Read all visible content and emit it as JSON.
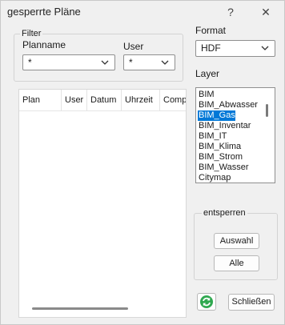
{
  "window": {
    "title": "gesperrte Pläne",
    "help_glyph": "?",
    "close_glyph": "✕"
  },
  "filter": {
    "group_label": "Filter",
    "planname_label": "Planname",
    "planname_value": "*",
    "user_label": "User",
    "user_value": "*"
  },
  "table": {
    "headers": [
      "Plan",
      "User",
      "Datum",
      "Uhrzeit",
      "Compu"
    ]
  },
  "format": {
    "label": "Format",
    "value": "HDF"
  },
  "layer": {
    "label": "Layer",
    "items": [
      "BIM",
      "BIM_Abwasser",
      "BIM_Gas",
      "BIM_Inventar",
      "BIM_IT",
      "BIM_Klima",
      "BIM_Strom",
      "BIM_Wasser",
      "Citymap"
    ],
    "selected": "BIM_Gas"
  },
  "entsperren": {
    "label": "entsperren",
    "auswahl": "Auswahl",
    "alle": "Alle"
  },
  "footer": {
    "close_label": "Schließen",
    "refresh_icon": "refresh-icon",
    "accent": "#2fa84f"
  }
}
